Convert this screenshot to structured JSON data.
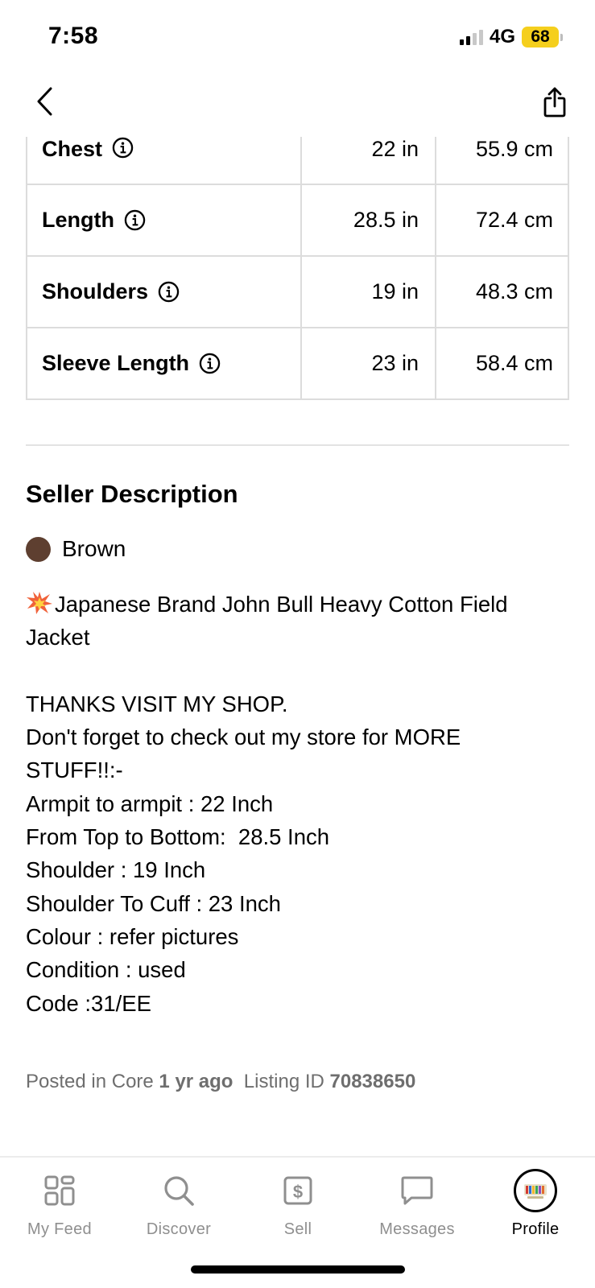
{
  "status_bar": {
    "time": "7:58",
    "network": "4G",
    "battery": "68",
    "battery_color": "#f5cf1d"
  },
  "nav": {
    "back_icon": "chevron-left-icon",
    "share_icon": "share-icon"
  },
  "measurements": [
    {
      "label": "Chest",
      "inches": "22 in",
      "cm": "55.9 cm"
    },
    {
      "label": "Length",
      "inches": "28.5 in",
      "cm": "72.4 cm"
    },
    {
      "label": "Shoulders",
      "inches": "19 in",
      "cm": "48.3 cm"
    },
    {
      "label": "Sleeve Length",
      "inches": "23 in",
      "cm": "58.4 cm"
    }
  ],
  "seller_description": {
    "title": "Seller Description",
    "color_name": "Brown",
    "color_hex": "#5e3f30",
    "lines": [
      "Japanese Brand John Bull Heavy Cotton Field",
      "Jacket",
      "",
      "THANKS VISIT MY SHOP.",
      "Don't forget to check out my store for MORE",
      "STUFF!!:-",
      "Armpit to armpit : 22 Inch",
      "From Top to Bottom:  28.5 Inch",
      "Shoulder : 19 Inch",
      "Shoulder To Cuff : 23 Inch",
      "Colour : refer pictures",
      "Condition : used",
      "Code :31/EE"
    ]
  },
  "meta": {
    "posted_prefix": "Posted in Core ",
    "posted_time": "1 yr ago",
    "listing_prefix": "  Listing ID ",
    "listing_id": "70838650"
  },
  "tabs": [
    {
      "label": "My Feed",
      "icon": "grid-icon",
      "active": false
    },
    {
      "label": "Discover",
      "icon": "search-icon",
      "active": false
    },
    {
      "label": "Sell",
      "icon": "dollar-tag-icon",
      "active": false
    },
    {
      "label": "Messages",
      "icon": "chat-bubble-icon",
      "active": false
    },
    {
      "label": "Profile",
      "icon": "avatar-icon",
      "active": true
    }
  ]
}
